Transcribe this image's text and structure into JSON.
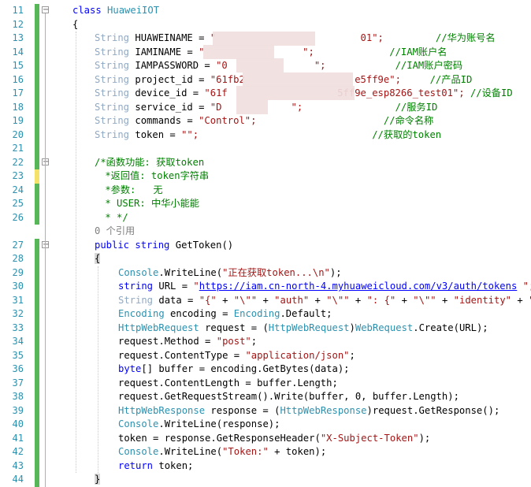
{
  "editor": {
    "lines": [
      {
        "num": "11",
        "tokens": [
          {
            "t": "class ",
            "c": "kw"
          },
          {
            "t": "HuaweiIOT",
            "c": "ty"
          }
        ]
      },
      {
        "num": "12",
        "tokens": [
          {
            "t": "{",
            "c": ""
          }
        ]
      },
      {
        "num": "13",
        "tokens": [
          {
            "t": "String",
            "c": "ty2"
          },
          {
            "t": " HUAWEINAME = ",
            "c": ""
          },
          {
            "t": "\"                         01\";",
            "c": "st"
          },
          {
            "t": "         //华为账号名",
            "c": "cm"
          }
        ]
      },
      {
        "num": "14",
        "tokens": [
          {
            "t": "String",
            "c": "ty2"
          },
          {
            "t": " IAMINAME = ",
            "c": ""
          },
          {
            "t": "\"                 \";",
            "c": "st"
          },
          {
            "t": "             //IAM账户名",
            "c": "cm"
          }
        ]
      },
      {
        "num": "15",
        "tokens": [
          {
            "t": "String",
            "c": "ty2"
          },
          {
            "t": " IAMPASSWORD = ",
            "c": ""
          },
          {
            "t": "\"0               \";",
            "c": "st"
          },
          {
            "t": "            //IAM账户密码",
            "c": "cm"
          }
        ]
      },
      {
        "num": "16",
        "tokens": [
          {
            "t": "String",
            "c": "ty2"
          },
          {
            "t": " project_id = ",
            "c": ""
          },
          {
            "t": "\"61fb2                   e5ff9e\";",
            "c": "st"
          },
          {
            "t": "     //产品ID",
            "c": "cm"
          }
        ]
      },
      {
        "num": "17",
        "tokens": [
          {
            "t": "String",
            "c": "ty2"
          },
          {
            "t": " device_id = ",
            "c": ""
          },
          {
            "t": "\"61f                   5ff9e_esp8266_test01\";",
            "c": "st"
          },
          {
            "t": " //设备ID",
            "c": "cm"
          }
        ]
      },
      {
        "num": "18",
        "tokens": [
          {
            "t": "String",
            "c": "ty2"
          },
          {
            "t": " service_id = ",
            "c": ""
          },
          {
            "t": "\"D            \";",
            "c": "st"
          },
          {
            "t": "                //服务ID",
            "c": "cm"
          }
        ]
      },
      {
        "num": "19",
        "tokens": [
          {
            "t": "String",
            "c": "ty2"
          },
          {
            "t": " commands = ",
            "c": ""
          },
          {
            "t": "\"Control\";",
            "c": "st"
          },
          {
            "t": "                      //命令名称",
            "c": "cm"
          }
        ]
      },
      {
        "num": "20",
        "tokens": [
          {
            "t": "String",
            "c": "ty2"
          },
          {
            "t": " token = ",
            "c": ""
          },
          {
            "t": "\"\";",
            "c": "st"
          },
          {
            "t": "                              //获取的token",
            "c": "cm"
          }
        ]
      },
      {
        "num": "21",
        "tokens": []
      },
      {
        "num": "22",
        "tokens": [
          {
            "t": "/*函数功能: 获取token",
            "c": "cm"
          }
        ]
      },
      {
        "num": "23",
        "tokens": [
          {
            "t": " *返回值: token字符串",
            "c": "cm"
          }
        ]
      },
      {
        "num": "24",
        "tokens": [
          {
            "t": " *参数:   无",
            "c": "cm"
          }
        ]
      },
      {
        "num": "25",
        "tokens": [
          {
            "t": " * USER: 中华小能能",
            "c": "cm"
          }
        ]
      },
      {
        "num": "26",
        "tokens": [
          {
            "t": " * */",
            "c": "cm"
          }
        ]
      },
      {
        "num": "",
        "tokens": [
          {
            "t": "0 个引用",
            "c": "gr"
          }
        ]
      },
      {
        "num": "27",
        "tokens": [
          {
            "t": "public ",
            "c": "kw"
          },
          {
            "t": "string ",
            "c": "kw"
          },
          {
            "t": "GetToken()",
            "c": ""
          }
        ]
      },
      {
        "num": "28",
        "tokens": [
          {
            "t": "{",
            "c": "bracehl"
          }
        ]
      },
      {
        "num": "29",
        "tokens": [
          {
            "t": "Console",
            "c": "ty"
          },
          {
            "t": ".WriteLine(",
            "c": ""
          },
          {
            "t": "\"正在获取token...\\n\"",
            "c": "st"
          },
          {
            "t": ");",
            "c": ""
          }
        ]
      },
      {
        "num": "30",
        "tokens": [
          {
            "t": "string ",
            "c": "kw"
          },
          {
            "t": "URL = ",
            "c": ""
          },
          {
            "t": "\"",
            "c": "st"
          },
          {
            "t": "https://iam.cn-north-4.myhuaweicloud.com/v3/auth/tokens",
            "c": "url"
          },
          {
            "t": " \";",
            "c": "st"
          }
        ]
      },
      {
        "num": "31",
        "tokens": [
          {
            "t": "String",
            "c": "ty2"
          },
          {
            "t": " data = ",
            "c": ""
          },
          {
            "t": "\"{\"",
            "c": "st"
          },
          {
            "t": " + ",
            "c": ""
          },
          {
            "t": "\"\\\"\"",
            "c": "st"
          },
          {
            "t": " + ",
            "c": ""
          },
          {
            "t": "\"auth\"",
            "c": "st"
          },
          {
            "t": " + ",
            "c": ""
          },
          {
            "t": "\"\\\"\"",
            "c": "st"
          },
          {
            "t": " + ",
            "c": ""
          },
          {
            "t": "\": {\"",
            "c": "st"
          },
          {
            "t": " + ",
            "c": ""
          },
          {
            "t": "\"\\\"\"",
            "c": "st"
          },
          {
            "t": " + ",
            "c": ""
          },
          {
            "t": "\"identity\"",
            "c": "st"
          },
          {
            "t": " + ",
            "c": ""
          },
          {
            "t": "\"\\",
            "c": "st"
          }
        ]
      },
      {
        "num": "32",
        "tokens": [
          {
            "t": "Encoding",
            "c": "ty"
          },
          {
            "t": " encoding = ",
            "c": ""
          },
          {
            "t": "Encoding",
            "c": "ty"
          },
          {
            "t": ".Default;",
            "c": ""
          }
        ]
      },
      {
        "num": "33",
        "tokens": [
          {
            "t": "HttpWebRequest",
            "c": "ty"
          },
          {
            "t": " request = (",
            "c": ""
          },
          {
            "t": "HttpWebRequest",
            "c": "ty"
          },
          {
            "t": ")",
            "c": ""
          },
          {
            "t": "WebRequest",
            "c": "ty"
          },
          {
            "t": ".Create(URL);",
            "c": ""
          }
        ]
      },
      {
        "num": "34",
        "tokens": [
          {
            "t": "request.Method = ",
            "c": ""
          },
          {
            "t": "\"post\"",
            "c": "st"
          },
          {
            "t": ";",
            "c": ""
          }
        ]
      },
      {
        "num": "35",
        "tokens": [
          {
            "t": "request.ContentType = ",
            "c": ""
          },
          {
            "t": "\"application/json\"",
            "c": "st"
          },
          {
            "t": ";",
            "c": ""
          }
        ]
      },
      {
        "num": "36",
        "tokens": [
          {
            "t": "byte",
            "c": "kw"
          },
          {
            "t": "[] buffer = encoding.GetBytes(data);",
            "c": ""
          }
        ]
      },
      {
        "num": "37",
        "tokens": [
          {
            "t": "request.ContentLength = buffer.Length;",
            "c": ""
          }
        ]
      },
      {
        "num": "38",
        "tokens": [
          {
            "t": "request.GetRequestStream().Write(buffer, 0, buffer.Length);",
            "c": ""
          }
        ]
      },
      {
        "num": "39",
        "tokens": [
          {
            "t": "HttpWebResponse",
            "c": "ty"
          },
          {
            "t": " response = (",
            "c": ""
          },
          {
            "t": "HttpWebResponse",
            "c": "ty"
          },
          {
            "t": ")request.GetResponse();",
            "c": ""
          }
        ]
      },
      {
        "num": "40",
        "tokens": [
          {
            "t": "Console",
            "c": "ty"
          },
          {
            "t": ".WriteLine(response);",
            "c": ""
          }
        ]
      },
      {
        "num": "41",
        "tokens": [
          {
            "t": "token = response.GetResponseHeader(",
            "c": ""
          },
          {
            "t": "\"X-Subject-Token\"",
            "c": "st"
          },
          {
            "t": ");",
            "c": ""
          }
        ]
      },
      {
        "num": "42",
        "tokens": [
          {
            "t": "Console",
            "c": "ty"
          },
          {
            "t": ".WriteLine(",
            "c": ""
          },
          {
            "t": "\"Token:\"",
            "c": "st"
          },
          {
            "t": " + token);",
            "c": ""
          }
        ]
      },
      {
        "num": "43",
        "tokens": [
          {
            "t": "return ",
            "c": "kw"
          },
          {
            "t": "token;",
            "c": ""
          }
        ]
      },
      {
        "num": "44",
        "tokens": [
          {
            "t": "}",
            "c": "bracehl"
          }
        ]
      }
    ]
  },
  "colors": {
    "line_number": "#2b91af",
    "keyword": "#0000ff",
    "type": "#2b91af",
    "string": "#a31515",
    "comment": "#008000",
    "change_saved": "#57b657",
    "change_unsaved": "#f4e26a"
  }
}
